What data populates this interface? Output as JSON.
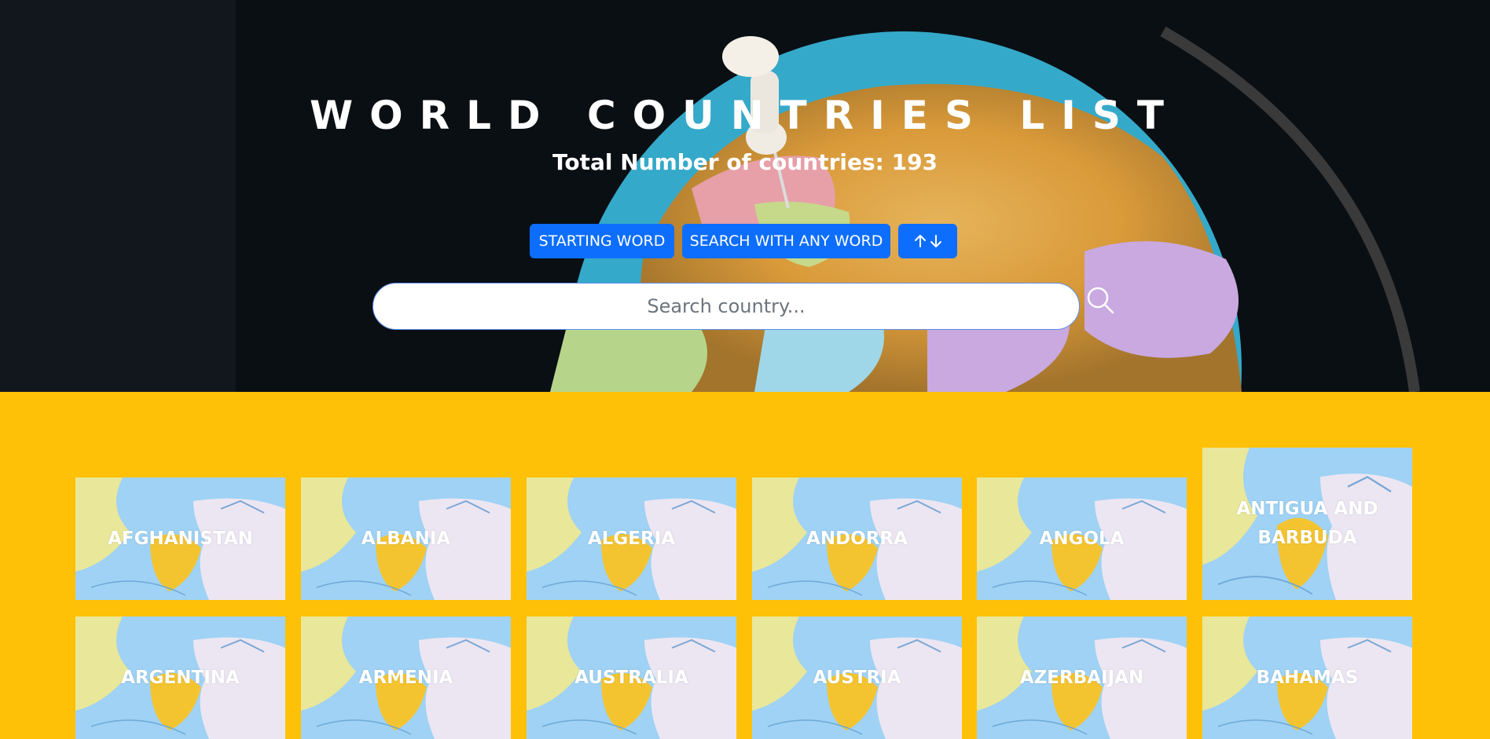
{
  "hero": {
    "title": "WORLD COUNTRIES LIST",
    "subtitle": "Total Number of countries: 193",
    "buttons": {
      "starting_word": "STARTING WORD",
      "any_word": "SEARCH WITH ANY WORD",
      "sort_icon": "arrow-up-down-icon"
    },
    "search": {
      "placeholder": "Search country...",
      "value": "",
      "icon": "search-icon"
    }
  },
  "colors": {
    "accent": "#0d6efd",
    "section_bg": "#ffc107",
    "hero_bg": "#0a0f14"
  },
  "countries": [
    "AFGHANISTAN",
    "ALBANIA",
    "ALGERIA",
    "ANDORRA",
    "ANGOLA",
    "ANTIGUA AND BARBUDA",
    "ARGENTINA",
    "ARMENIA",
    "AUSTRALIA",
    "AUSTRIA",
    "AZERBAIJAN",
    "BAHAMAS"
  ]
}
